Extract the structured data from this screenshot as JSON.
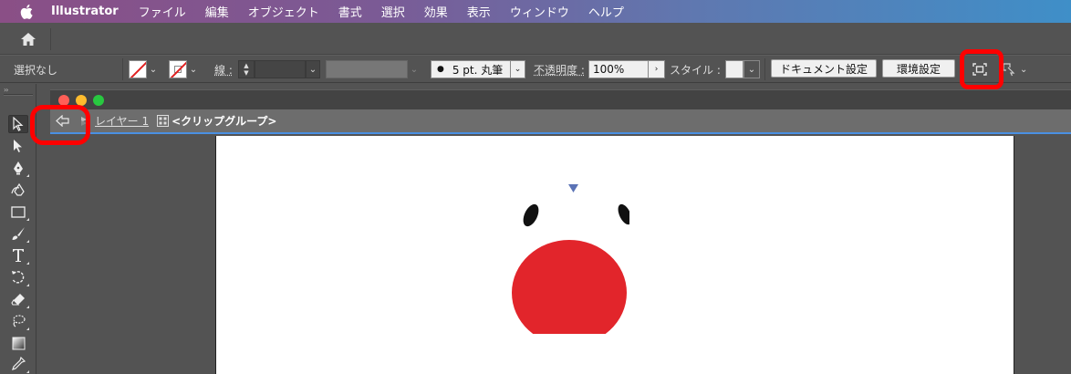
{
  "menubar": {
    "app_name": "Illustrator",
    "items": [
      "ファイル",
      "編集",
      "オブジェクト",
      "書式",
      "選択",
      "効果",
      "表示",
      "ウィンドウ",
      "ヘルプ"
    ]
  },
  "controlbar": {
    "selection_status": "選択なし",
    "stroke_label": "線 :",
    "brush_value": "5 pt. 丸筆",
    "opacity_label": "不透明度 :",
    "opacity_value": "100%",
    "style_label": "スタイル :",
    "document_setup": "ドキュメント設定",
    "preferences": "環境設定"
  },
  "isolation": {
    "layer": "レイヤー 1",
    "group": "<クリップグループ>"
  },
  "colors": {
    "highlight_ring": "#ff0000",
    "apple_red": "#e2252b",
    "isolation_border": "#4a90e2",
    "close": "#ff5f57",
    "minimize": "#febc2e",
    "zoom": "#28c840"
  },
  "icons": [
    "apple-icon",
    "home-icon",
    "back-arrow-icon",
    "layer-icon",
    "group-icon",
    "frame-icon",
    "arrange-icon",
    "selection-tool-icon",
    "direct-selection-tool-icon",
    "pen-tool-icon",
    "curvature-tool-icon",
    "rectangle-tool-icon",
    "paintbrush-tool-icon",
    "type-tool-icon",
    "rotate-tool-icon",
    "eraser-tool-icon",
    "lasso-tool-icon",
    "gradient-tool-icon",
    "eyedropper-tool-icon"
  ]
}
